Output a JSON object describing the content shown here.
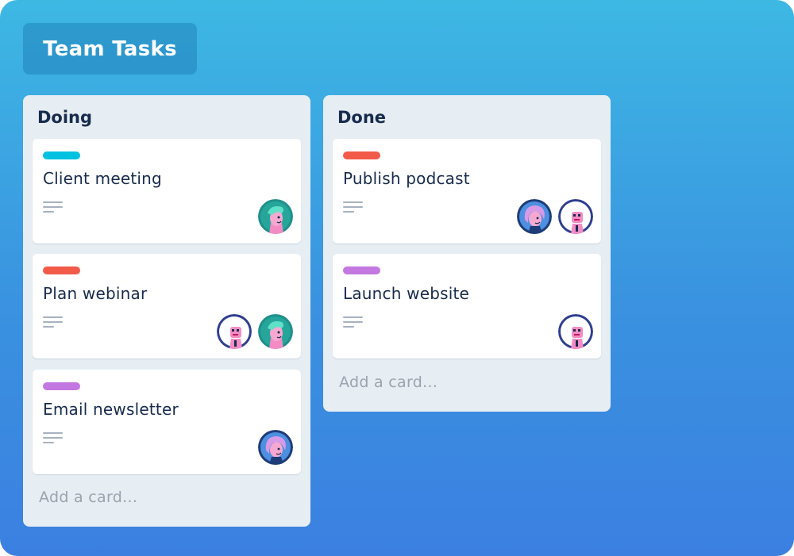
{
  "board": {
    "title": "Team Tasks"
  },
  "lists": [
    {
      "title": "Doing",
      "cards": [
        {
          "title": "Client meeting",
          "label_color": "#00c2e0",
          "avatars": [
            "teal-hair-person-avatar"
          ]
        },
        {
          "title": "Plan webinar",
          "label_color": "#f25a4a",
          "avatars": [
            "pink-character-avatar",
            "teal-hair-person-avatar"
          ]
        },
        {
          "title": "Email newsletter",
          "label_color": "#c377e0",
          "avatars": [
            "pink-hair-person-avatar"
          ]
        }
      ],
      "add_card_label": "Add a card..."
    },
    {
      "title": "Done",
      "cards": [
        {
          "title": "Publish podcast",
          "label_color": "#f25a4a",
          "avatars": [
            "pink-hair-person-avatar",
            "pink-character-avatar"
          ]
        },
        {
          "title": "Launch website",
          "label_color": "#c377e0",
          "avatars": [
            "pink-character-avatar"
          ]
        }
      ],
      "add_card_label": "Add a card..."
    }
  ],
  "icons": {
    "description": "description-lines-icon"
  },
  "colors": {
    "background_top": "#3db8e3",
    "background_bottom": "#3b80e1",
    "list_bg": "#e6edf3",
    "text": "#172b4d"
  }
}
